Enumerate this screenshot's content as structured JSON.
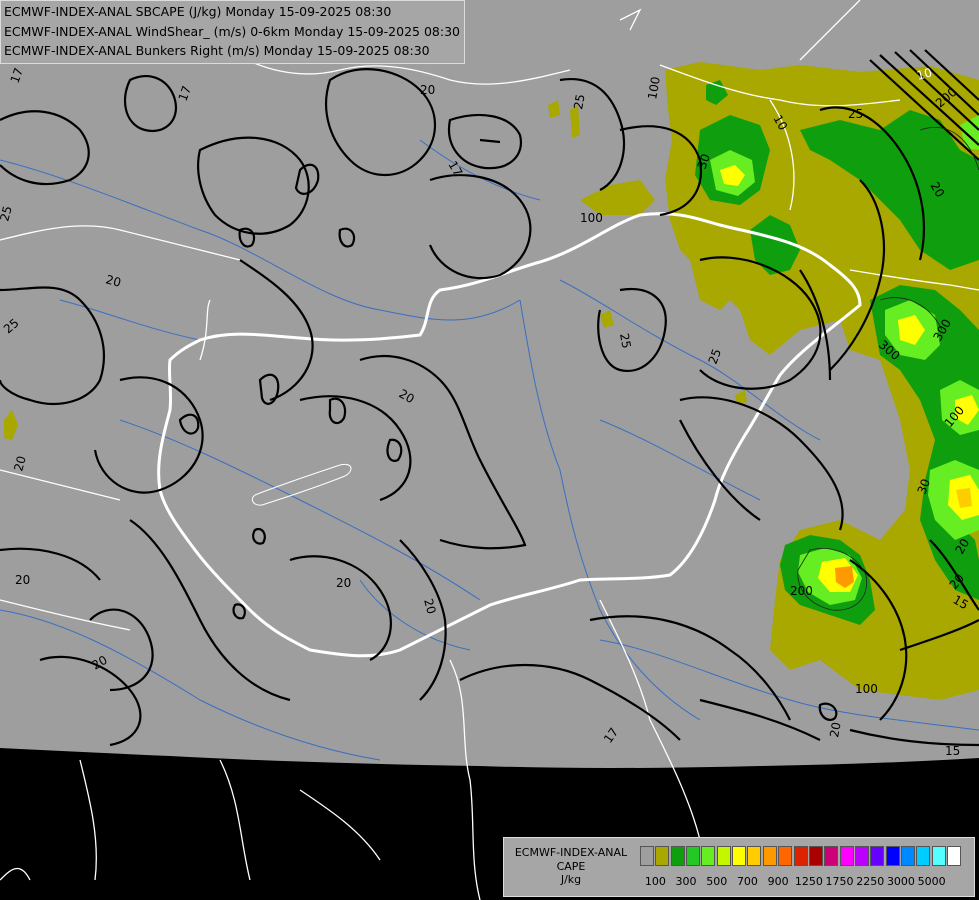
{
  "header": {
    "line1": "ECMWF-INDEX-ANAL SBCAPE (J/kg) Monday 15-09-2025 08:30",
    "line2": "ECMWF-INDEX-ANAL WindShear_ (m/s) 0-6km Monday 15-09-2025 08:30",
    "line3": "ECMWF-INDEX-ANAL Bunkers Right (m/s) Monday 15-09-2025 08:30"
  },
  "legend": {
    "title_line1": "ECMWF-INDEX-ANAL",
    "title_line2": "CAPE",
    "title_line3": "J/kg",
    "swatches": [
      "#9e9e9e",
      "#a8a800",
      "#0e9e0e",
      "#24c824",
      "#66ee22",
      "#c4f600",
      "#ffff00",
      "#ffcc00",
      "#ff9900",
      "#ff6600",
      "#dd2200",
      "#aa0000",
      "#cc0077",
      "#ff00ff",
      "#bb00ff",
      "#6600ff",
      "#0000ff",
      "#0088ff",
      "#00ccff",
      "#55ffff",
      "#ffffff"
    ],
    "tick_labels": [
      "100",
      "300",
      "500",
      "700",
      "900",
      "1250",
      "1750",
      "2250",
      "3000",
      "5000"
    ]
  },
  "contour_labels": {
    "shear": [
      "17",
      "17",
      "20",
      "20",
      "20",
      "20",
      "20",
      "20",
      "20",
      "20",
      "20",
      "20",
      "25",
      "25",
      "25",
      "25",
      "25",
      "25",
      "17",
      "17",
      "15",
      "15",
      "20",
      "20",
      "30",
      "30",
      "10",
      "10"
    ],
    "cape": [
      "100",
      "200",
      "300",
      "300",
      "100",
      "200",
      "100",
      "100"
    ]
  },
  "colors": {
    "background": "#9e9e9e",
    "outside": "#000000",
    "contour": "#000000",
    "borders": "#ffffff",
    "rivers": "#3a6fc0",
    "cape_100": "#a8a800",
    "cape_300": "#0e9e0e",
    "cape_500": "#66ee22",
    "cape_700": "#ffff00",
    "cape_900": "#ff9900"
  }
}
